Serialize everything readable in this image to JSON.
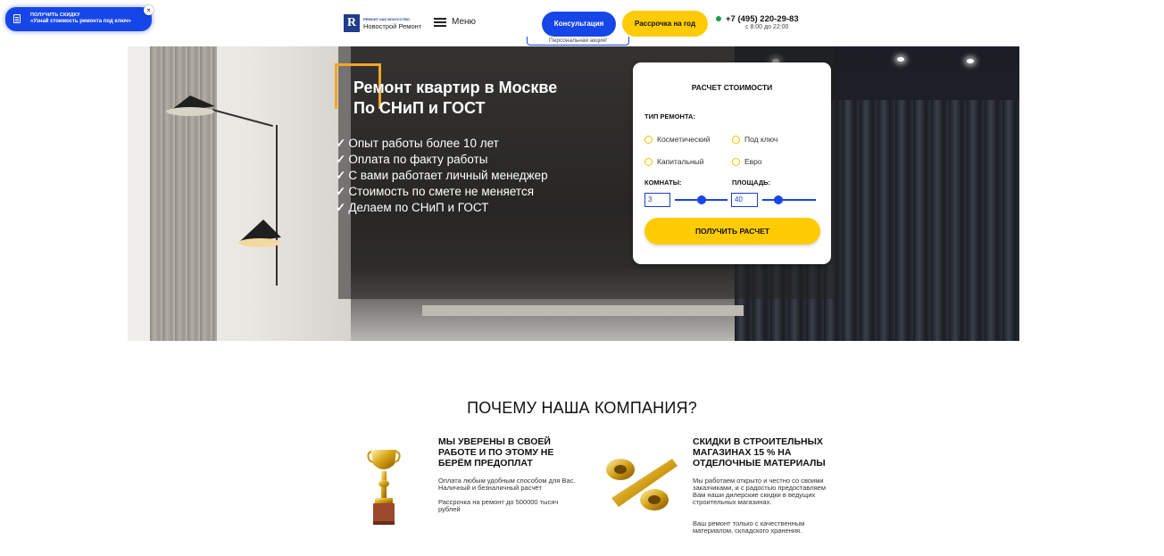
{
  "promo": {
    "line1": "ПОЛУЧИТЬ СКИДКУ",
    "line2": "«Узнай стоимость ремонта под ключ»",
    "close": "×"
  },
  "header": {
    "logo_top": "РЕМОНТ КАК ИСКУССТВО",
    "logo_name": "Новострой Ремонт",
    "logo_letter": "R",
    "menu_label": "Меню",
    "consult_label": "Консультация",
    "installment_label": "Рассрочка на год",
    "personal_label": "Персональная акция!",
    "phone": "+7 (495) 220-29-83",
    "hours": "с 8:00 до 22:00"
  },
  "hero": {
    "title_line1": "Ремонт квартир в Москве",
    "title_line2": "По СНиП и ГОСТ",
    "features": [
      "Опыт работы более 10 лет",
      "Оплата по факту работы",
      "С вами работает личный менеджер",
      "Стоимость по смете не меняется",
      "Делаем по СНиП и ГОСТ"
    ],
    "check": "✓"
  },
  "calc": {
    "title": "РАСЧЕТ СТОИМОСТИ",
    "type_label": "ТИП РЕМОНТА:",
    "options": [
      "Косметический",
      "Под ключ",
      "Капитальный",
      "Евро"
    ],
    "rooms_label": "КОМНАТЫ:",
    "rooms_value": "3",
    "rooms_level": 0.5,
    "area_label": "ПЛОЩАДЬ:",
    "area_value": "40",
    "area_level": 0.3,
    "submit": "ПОЛУЧИТЬ РАСЧЕТ"
  },
  "why": {
    "title": "ПОЧЕМУ НАША КОМПАНИЯ?",
    "card1": {
      "title": "МЫ УВЕРЕНЫ В СВОЕЙ РАБОТЕ И ПО ЭТОМУ НЕ БЕРЁМ ПРЕДОПЛАТ",
      "text1": "Оплата любым удобным способом для Вас. Наличный и безналичный расчёт",
      "text2": "Рассрочка на ремонт до 500000 тысяч рублей"
    },
    "card2": {
      "title": "СКИДКИ В СТРОИТЕЛЬНЫХ МАГАЗИНАХ 15 % НА ОТДЕЛОЧНЫЕ МАТЕРИАЛЫ",
      "text1": "Мы работаем открыто и честно со своими заказчиками, и с радостью предоставляем Вам наши дилерские скидки в ведущих строительных магазинах.",
      "text2": "Ваш ремонт только с качественным материалом, складского хранения."
    }
  },
  "colors": {
    "accent_blue": "#1746e8",
    "accent_yellow": "#ffcb05",
    "bracket_orange": "#f5a623"
  },
  "icons": [
    "document-icon",
    "close-icon",
    "hamburger-icon",
    "status-dot-icon",
    "trophy-icon",
    "percent-icon"
  ]
}
